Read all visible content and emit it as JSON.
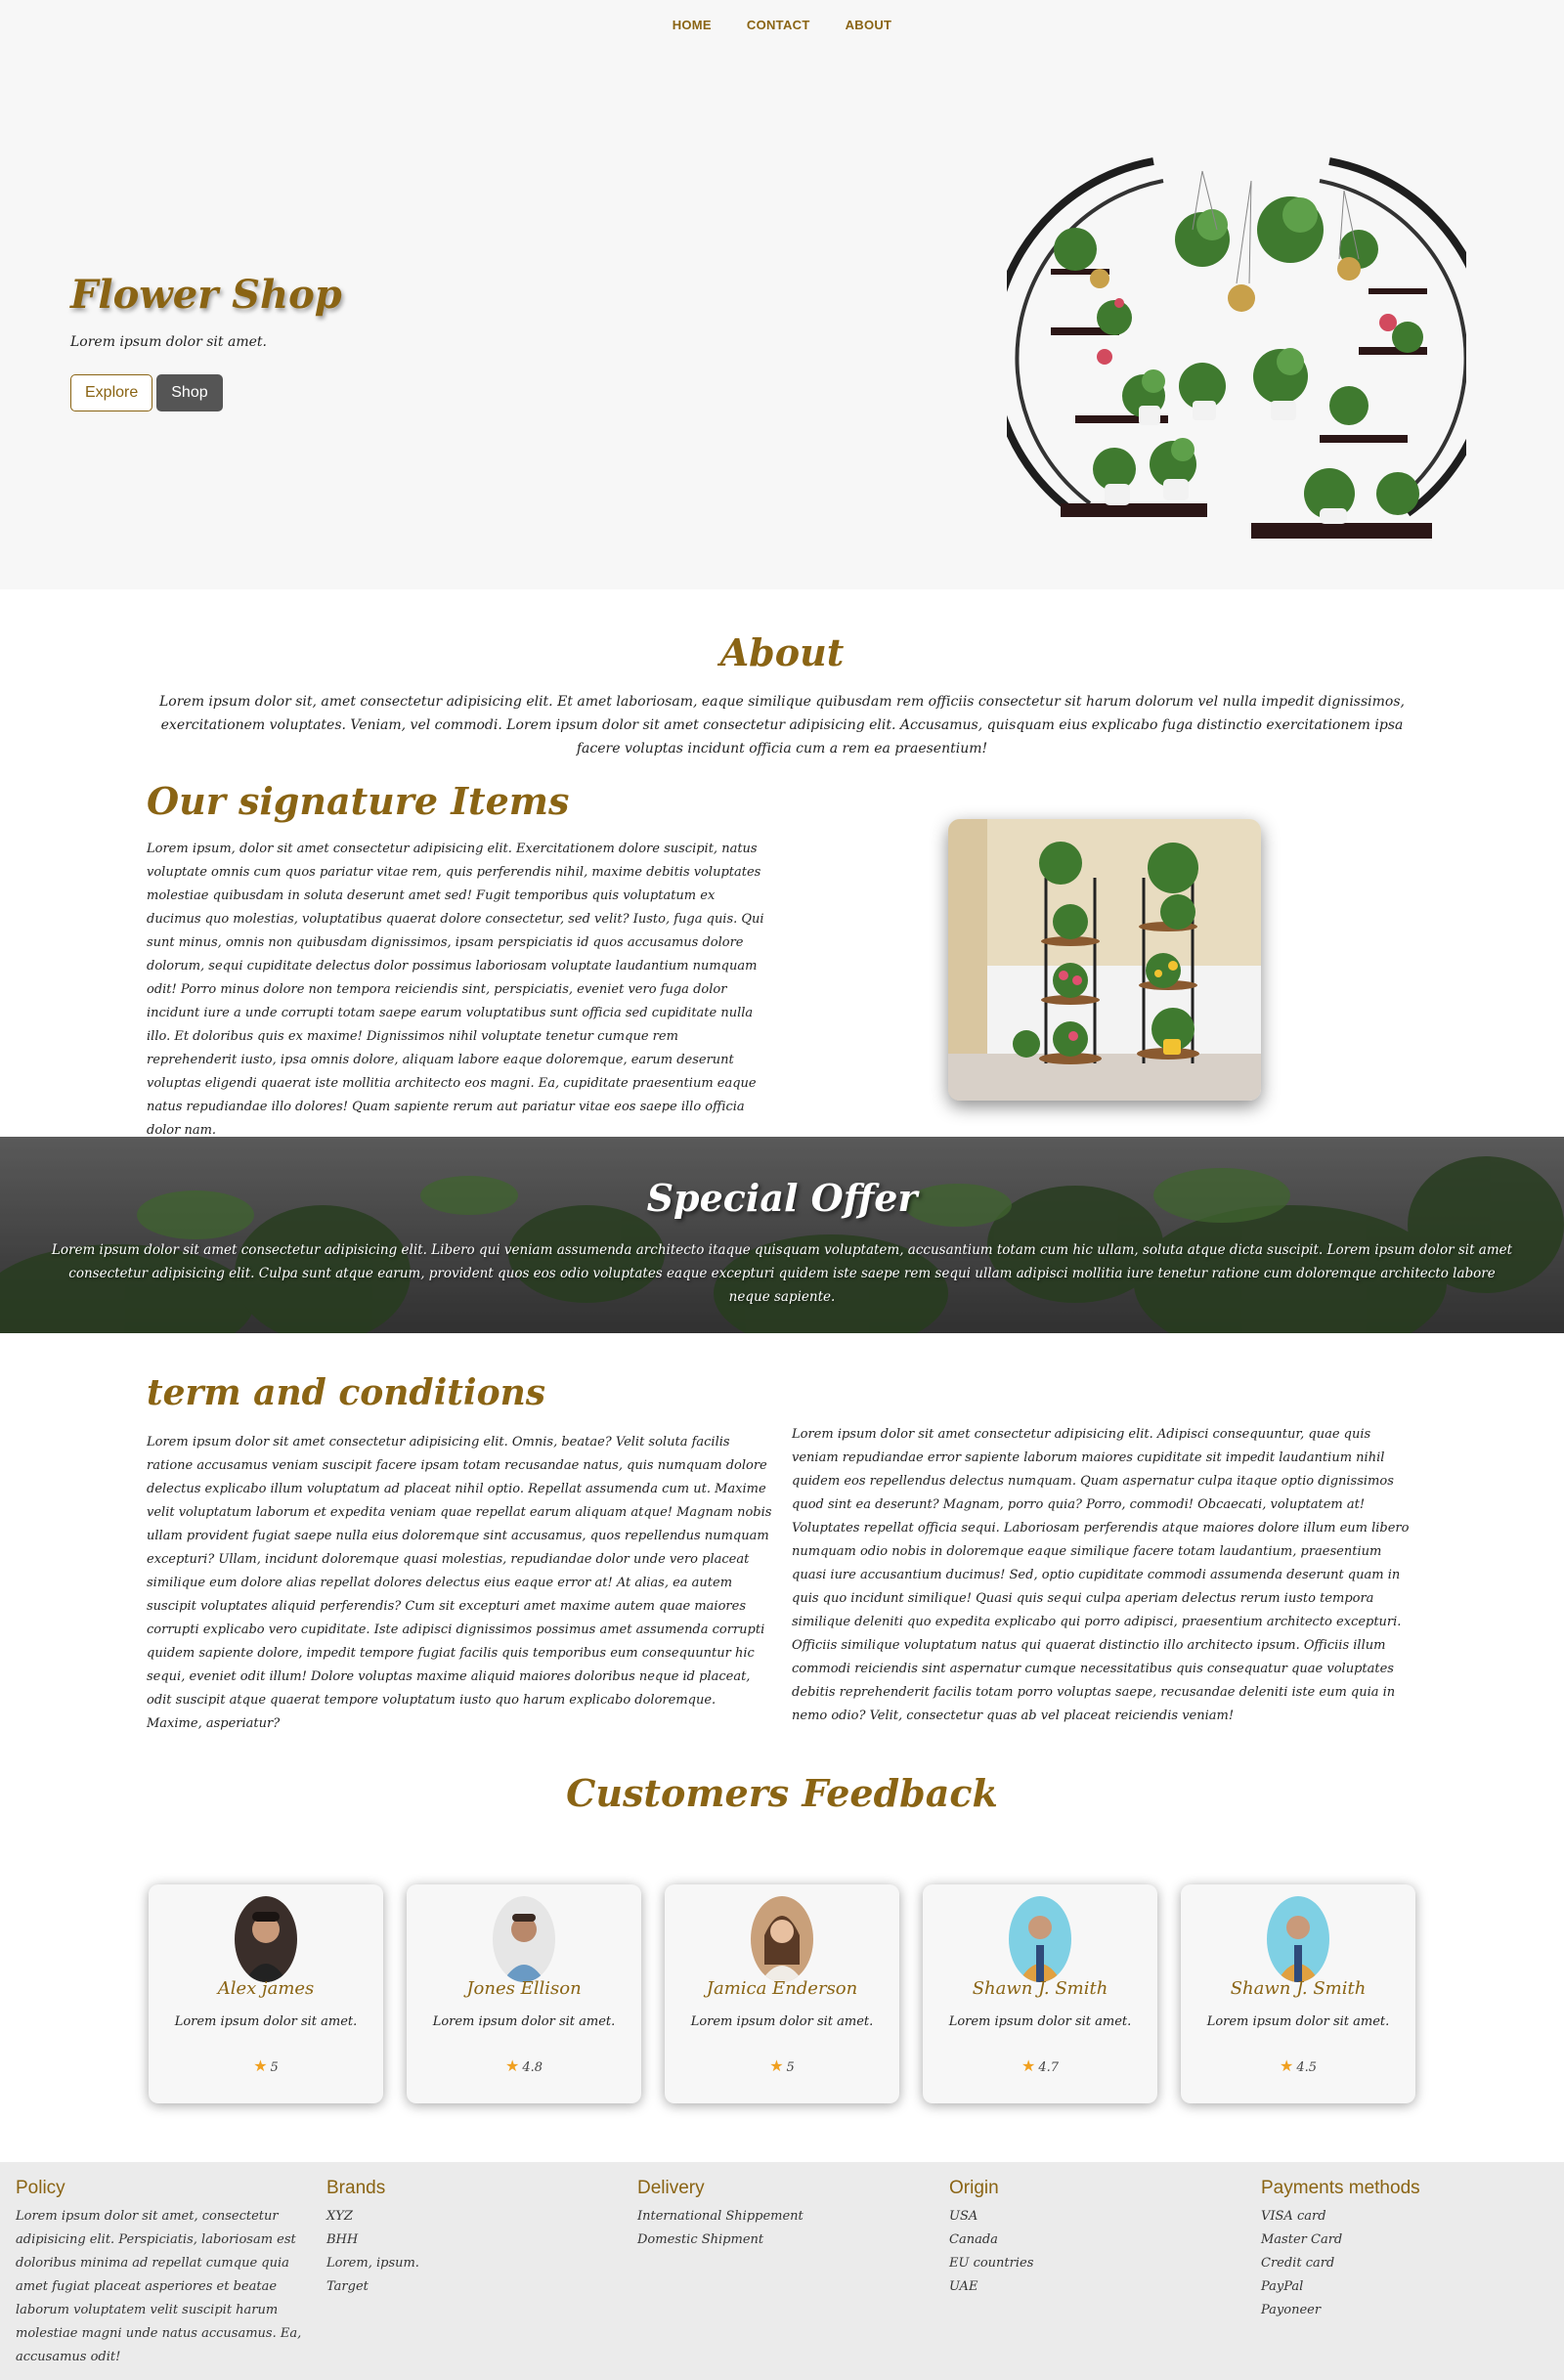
{
  "nav": {
    "items": [
      "HOME",
      "CONTACT",
      "ABOUT"
    ]
  },
  "hero": {
    "title": "Flower Shop",
    "subtitle": "Lorem ipsum dolor sit amet.",
    "explore_label": "Explore",
    "shop_label": "Shop"
  },
  "about": {
    "title": "About",
    "text": "Lorem ipsum dolor sit, amet consectetur adipisicing elit. Et amet laboriosam, eaque similique quibusdam rem officiis consectetur sit harum dolorum vel nulla impedit dignissimos, exercitationem voluptates. Veniam, vel commodi. Lorem ipsum dolor sit amet consectetur adipisicing elit. Accusamus, quisquam eius explicabo fuga distinctio exercitationem ipsa facere voluptas incidunt officia cum a rem ea praesentium!"
  },
  "signature": {
    "title": "Our signature Items",
    "text": "Lorem ipsum, dolor sit amet consectetur adipisicing elit. Exercitationem dolore suscipit, natus voluptate omnis cum quos pariatur vitae rem, quis perferendis nihil, maxime debitis voluptates molestiae quibusdam in soluta deserunt amet sed! Fugit temporibus quis voluptatum ex ducimus quo molestias, voluptatibus quaerat dolore consectetur, sed velit? Iusto, fuga quis. Qui sunt minus, omnis non quibusdam dignissimos, ipsam perspiciatis id quos accusamus dolore dolorum, sequi cupiditate delectus dolor possimus laboriosam voluptate laudantium numquam odit! Porro minus dolore non tempora reiciendis sint, perspiciatis, eveniet vero fuga dolor incidunt iure a unde corrupti totam saepe earum voluptatibus sunt officia sed cupiditate nulla illo. Et doloribus quis ex maxime! Dignissimos nihil voluptate tenetur cumque rem reprehenderit iusto, ipsa omnis dolore, aliquam labore eaque doloremque, earum deserunt voluptas eligendi quaerat iste mollitia architecto eos magni. Ea, cupiditate praesentium eaque natus repudiandae illo dolores! Quam sapiente rerum aut pariatur vitae eos saepe illo officia dolor nam."
  },
  "offer": {
    "title": "Special Offer",
    "text": "Lorem ipsum dolor sit amet consectetur adipisicing elit. Libero qui veniam assumenda architecto itaque quisquam voluptatem, accusantium totam cum hic ullam, soluta atque dicta suscipit. Lorem ipsum dolor sit amet consectetur adipisicing elit. Culpa sunt atque earum, provident quos eos odio voluptates eaque excepturi quidem iste saepe rem sequi ullam adipisci mollitia iure tenetur ratione cum doloremque architecto labore neque sapiente."
  },
  "terms": {
    "title": "term and conditions",
    "left": "Lorem ipsum dolor sit amet consectetur adipisicing elit. Omnis, beatae? Velit soluta facilis ratione accusamus veniam suscipit facere ipsam totam recusandae natus, quis numquam dolore delectus explicabo illum voluptatum ad placeat nihil optio. Repellat assumenda cum ut. Maxime velit voluptatum laborum et expedita veniam quae repellat earum aliquam atque! Magnam nobis ullam provident fugiat saepe nulla eius doloremque sint accusamus, quos repellendus numquam excepturi? Ullam, incidunt doloremque quasi molestias, repudiandae dolor unde vero placeat similique eum dolore alias repellat dolores delectus eius eaque error at! At alias, ea autem suscipit voluptates aliquid perferendis? Cum sit excepturi amet maxime autem quae maiores corrupti explicabo vero cupiditate. Iste adipisci dignissimos possimus amet assumenda corrupti quidem sapiente dolore, impedit tempore fugiat facilis quis temporibus eum consequuntur hic sequi, eveniet odit illum! Dolore voluptas maxime aliquid maiores doloribus neque id placeat, odit suscipit atque quaerat tempore voluptatum iusto quo harum explicabo doloremque. Maxime, asperiatur?",
    "right": "Lorem ipsum dolor sit amet consectetur adipisicing elit. Adipisci consequuntur, quae quis veniam repudiandae error sapiente laborum maiores cupiditate sit impedit laudantium nihil quidem eos repellendus delectus numquam. Quam aspernatur culpa itaque optio dignissimos quod sint ea deserunt? Magnam, porro quia? Porro, commodi! Obcaecati, voluptatem at! Voluptates repellat officia sequi. Laboriosam perferendis atque maiores dolore illum eum libero numquam odio nobis in doloremque eaque similique facere totam laudantium, praesentium quasi iure accusantium ducimus! Sed, optio cupiditate commodi assumenda deserunt quam in quis quo incidunt similique! Quasi quis sequi culpa aperiam delectus rerum iusto tempora similique deleniti quo expedita explicabo qui porro adipisci, praesentium architecto excepturi. Officiis similique voluptatum natus qui quaerat distinctio illo architecto ipsum. Officiis illum commodi reiciendis sint aspernatur cumque necessitatibus quis consequatur quae voluptates debitis reprehenderit facilis totam porro voluptas saepe, recusandae deleniti iste eum quia in nemo odio? Velit, consectetur quas ab vel placeat reiciendis veniam!"
  },
  "feedback": {
    "title": "Customers Feedback",
    "cards": [
      {
        "name": "Alex james",
        "text": "Lorem ipsum dolor sit amet.",
        "rating": "5",
        "avatar_bg": "#3a2e2a"
      },
      {
        "name": "Jones Ellison",
        "text": "Lorem ipsum dolor sit amet.",
        "rating": "4.8",
        "avatar_bg": "#e6e6e6"
      },
      {
        "name": "Jamica Enderson",
        "text": "Lorem ipsum dolor sit amet.",
        "rating": "5",
        "avatar_bg": "#c9a07a"
      },
      {
        "name": "Shawn J. Smith",
        "text": "Lorem ipsum dolor sit amet.",
        "rating": "4.7",
        "avatar_bg": "#7fd0e4"
      },
      {
        "name": "Shawn J. Smith",
        "text": "Lorem ipsum dolor sit amet.",
        "rating": "4.5",
        "avatar_bg": "#7fd0e4"
      }
    ]
  },
  "footer": {
    "policy": {
      "title": "Policy",
      "text": "Lorem ipsum dolor sit amet, consectetur adipisicing elit. Perspiciatis, laboriosam est doloribus minima ad repellat cumque quia amet fugiat placeat asperiores et beatae laborum voluptatem velit suscipit harum molestiae magni unde natus accusamus. Ea, accusamus odit!"
    },
    "brands": {
      "title": "Brands",
      "items": [
        "XYZ",
        "BHH",
        "Lorem, ipsum.",
        "Target"
      ]
    },
    "delivery": {
      "title": "Delivery",
      "items": [
        "International Shippement",
        "Domestic Shipment"
      ]
    },
    "origin": {
      "title": "Origin",
      "items": [
        "USA",
        "Canada",
        "EU countries",
        "UAE"
      ]
    },
    "payments": {
      "title": "Payments methods",
      "items": [
        "VISA card",
        "Master Card",
        "Credit card",
        "PayPal",
        "Payoneer"
      ]
    }
  },
  "colors": {
    "accent": "#8a6414",
    "hero_bg": "#f7f7f7",
    "footer_bg": "#ebebeb"
  }
}
